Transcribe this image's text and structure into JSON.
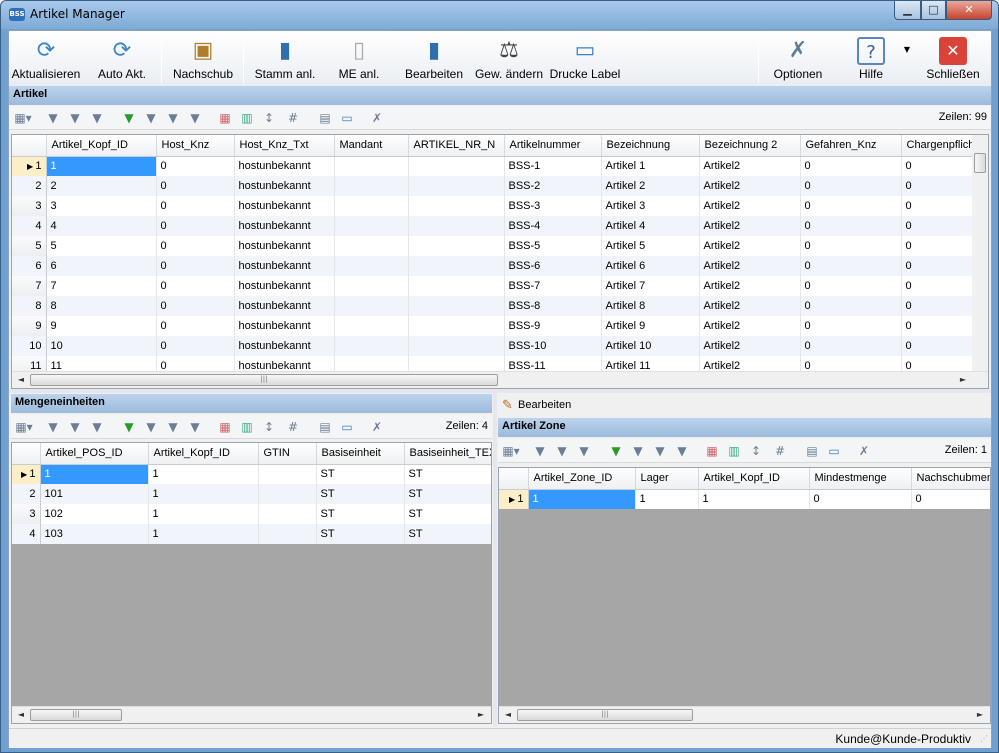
{
  "window": {
    "title": "Artikel Manager",
    "app_icon": "BSS",
    "minimize_label": "▁",
    "maximize_label": "□",
    "close_label": "✕"
  },
  "toolbar": {
    "buttons": [
      {
        "label": "Aktualisieren",
        "icon": "refresh-icon"
      },
      {
        "label": "Auto Akt.",
        "icon": "auto-refresh-icon"
      },
      {
        "label": "Nachschub",
        "icon": "replenish-icon"
      },
      {
        "label": "Stamm anl.",
        "icon": "new-master-icon"
      },
      {
        "label": "ME anl.",
        "icon": "new-unit-icon"
      },
      {
        "label": "Bearbeiten",
        "icon": "edit-icon"
      },
      {
        "label": "Gew. ändern",
        "icon": "weight-icon"
      },
      {
        "label": "Drucke Label",
        "icon": "printer-icon"
      },
      {
        "label": "Optionen",
        "icon": "tools-icon"
      },
      {
        "label": "Hilfe",
        "icon": "help-icon"
      },
      {
        "label": "Schließen",
        "icon": "close-icon"
      }
    ],
    "help_dropdown": "▼"
  },
  "artikel": {
    "title": "Artikel",
    "rows_label": "Zeilen: 99",
    "columns": [
      "Artikel_Kopf_ID",
      "Host_Knz",
      "Host_Knz_Txt",
      "Mandant",
      "ARTIKEL_NR_N",
      "Artikelnummer",
      "Bezeichnung",
      "Bezeichnung 2",
      "Gefahren_Knz",
      "Chargenpflicht"
    ],
    "rows": [
      {
        "n": "1",
        "c": [
          "1",
          "0",
          "hostunbekannt",
          "",
          "",
          "BSS-1",
          "Artikel 1",
          "Artikel2",
          "0",
          "0"
        ]
      },
      {
        "n": "2",
        "c": [
          "2",
          "0",
          "hostunbekannt",
          "",
          "",
          "BSS-2",
          "Artikel 2",
          "Artikel2",
          "0",
          "0"
        ]
      },
      {
        "n": "3",
        "c": [
          "3",
          "0",
          "hostunbekannt",
          "",
          "",
          "BSS-3",
          "Artikel 3",
          "Artikel2",
          "0",
          "0"
        ]
      },
      {
        "n": "4",
        "c": [
          "4",
          "0",
          "hostunbekannt",
          "",
          "",
          "BSS-4",
          "Artikel 4",
          "Artikel2",
          "0",
          "0"
        ]
      },
      {
        "n": "5",
        "c": [
          "5",
          "0",
          "hostunbekannt",
          "",
          "",
          "BSS-5",
          "Artikel 5",
          "Artikel2",
          "0",
          "0"
        ]
      },
      {
        "n": "6",
        "c": [
          "6",
          "0",
          "hostunbekannt",
          "",
          "",
          "BSS-6",
          "Artikel 6",
          "Artikel2",
          "0",
          "0"
        ]
      },
      {
        "n": "7",
        "c": [
          "7",
          "0",
          "hostunbekannt",
          "",
          "",
          "BSS-7",
          "Artikel 7",
          "Artikel2",
          "0",
          "0"
        ]
      },
      {
        "n": "8",
        "c": [
          "8",
          "0",
          "hostunbekannt",
          "",
          "",
          "BSS-8",
          "Artikel 8",
          "Artikel2",
          "0",
          "0"
        ]
      },
      {
        "n": "9",
        "c": [
          "9",
          "0",
          "hostunbekannt",
          "",
          "",
          "BSS-9",
          "Artikel 9",
          "Artikel2",
          "0",
          "0"
        ]
      },
      {
        "n": "10",
        "c": [
          "10",
          "0",
          "hostunbekannt",
          "",
          "",
          "BSS-10",
          "Artikel 10",
          "Artikel2",
          "0",
          "0"
        ]
      },
      {
        "n": "11",
        "c": [
          "11",
          "0",
          "hostunbekannt",
          "",
          "",
          "BSS-11",
          "Artikel 11",
          "Artikel2",
          "0",
          "0"
        ]
      }
    ]
  },
  "mengeneinheiten": {
    "title": "Mengeneinheiten",
    "rows_label": "Zeilen: 4",
    "columns": [
      "Artikel_POS_ID",
      "Artikel_Kopf_ID",
      "GTIN",
      "Basiseinheit",
      "Basiseinheit_TEXT"
    ],
    "rows": [
      {
        "n": "1",
        "c": [
          "1",
          "1",
          "",
          "ST",
          "ST"
        ]
      },
      {
        "n": "2",
        "c": [
          "101",
          "1",
          "",
          "ST",
          "ST"
        ]
      },
      {
        "n": "3",
        "c": [
          "102",
          "1",
          "",
          "ST",
          "ST"
        ]
      },
      {
        "n": "4",
        "c": [
          "103",
          "1",
          "",
          "ST",
          "ST"
        ]
      }
    ]
  },
  "bearbeiten_label": "Bearbeiten",
  "artikel_zone": {
    "title": "Artikel Zone",
    "rows_label": "Zeilen: 1",
    "columns": [
      "Artikel_Zone_ID",
      "Lager",
      "Artikel_Kopf_ID",
      "Mindestmenge",
      "Nachschubmenge"
    ],
    "rows": [
      {
        "n": "1",
        "c": [
          "1",
          "1",
          "1",
          "0",
          "0"
        ]
      }
    ]
  },
  "status": {
    "text": "Kunde@Kunde-Produktiv"
  },
  "colors": {
    "selection": "#3399ff",
    "title_bar": "#9dbadc"
  }
}
